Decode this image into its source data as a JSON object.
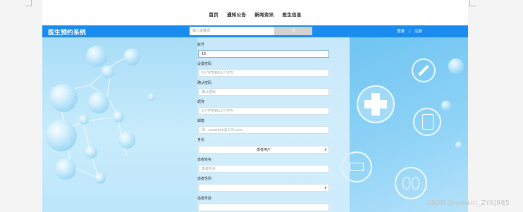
{
  "nav": {
    "items": [
      "首页",
      "通知公告",
      "新闻资讯",
      "医生信息"
    ]
  },
  "header": {
    "brand": "医生预约系统",
    "search_placeholder": "输入关键词",
    "search_button": "Q",
    "login": "登录",
    "separator": "|",
    "register": "注册"
  },
  "form": {
    "account_label": "账号",
    "account_value": "15",
    "password_label": "设置密码",
    "password_placeholder": "5个字符到16个字符",
    "confirm_label": "确认密码",
    "confirm_placeholder": "确认密码",
    "nickname_label": "昵称",
    "nickname_placeholder": "2个字符到12个字符",
    "email_label": "邮箱",
    "email_placeholder": "例：example@123.com",
    "identity_label": "身份",
    "identity_value": "患者用户",
    "patient_name_label": "患者姓名",
    "patient_name_placeholder": "患者姓名",
    "patient_gender_label": "患者性别",
    "patient_gender_value": "",
    "patient_age_label": "患者年龄"
  },
  "watermark": "CSDN @weixin_ZYKJ985",
  "colors": {
    "header_blue": "#1a8cf0",
    "hero_light": "#c8ecfb"
  }
}
